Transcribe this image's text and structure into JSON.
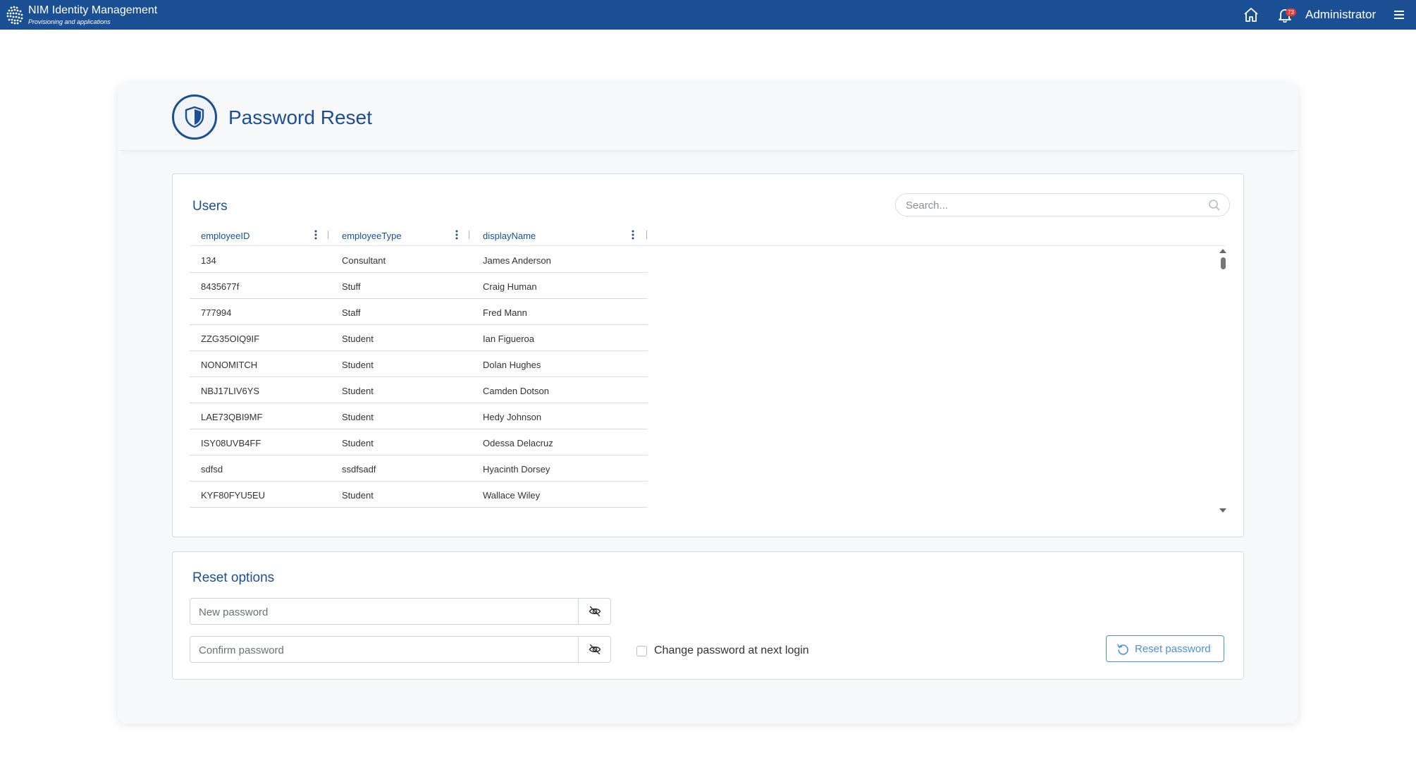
{
  "app": {
    "title": "NIM Identity Management",
    "subtitle": "Provisioning and applications"
  },
  "topbar": {
    "notification_count": "73",
    "user_name": "Administrator",
    "icons": [
      "home-icon",
      "bell-icon",
      "menu-icon"
    ]
  },
  "page": {
    "title": "Password Reset",
    "icon": "shield-icon"
  },
  "users": {
    "title": "Users",
    "search": {
      "placeholder": "Search...",
      "value": ""
    },
    "columns": [
      "employeeID",
      "employeeType",
      "displayName"
    ],
    "rows": [
      [
        "134",
        "Consultant",
        "James Anderson"
      ],
      [
        "8435677f",
        "Stuff",
        "Craig Human"
      ],
      [
        "777994",
        "Staff",
        "Fred Mann"
      ],
      [
        "ZZG35OIQ9IF",
        "Student",
        "Ian Figueroa"
      ],
      [
        "NONOMITCH",
        "Student",
        "Dolan Hughes"
      ],
      [
        "NBJ17LIV6YS",
        "Student",
        "Camden Dotson"
      ],
      [
        "LAE73QBI9MF",
        "Student",
        "Hedy Johnson"
      ],
      [
        "ISY08UVB4FF",
        "Student",
        "Odessa Delacruz"
      ],
      [
        "sdfsd",
        "ssdfsadf",
        "Hyacinth Dorsey"
      ],
      [
        "KYF80FYU5EU",
        "Student",
        "Wallace Wiley"
      ]
    ]
  },
  "reset": {
    "title": "Reset options",
    "new_password": {
      "placeholder": "New password",
      "value": ""
    },
    "confirm_password": {
      "placeholder": "Confirm password",
      "value": ""
    },
    "change_at_next_login_label": "Change password at next login",
    "change_at_next_login_checked": false,
    "reset_button_label": "Reset password"
  },
  "colors": {
    "brand": "#1b4f93",
    "accent": "#4a90e2",
    "badge": "#e53935"
  }
}
